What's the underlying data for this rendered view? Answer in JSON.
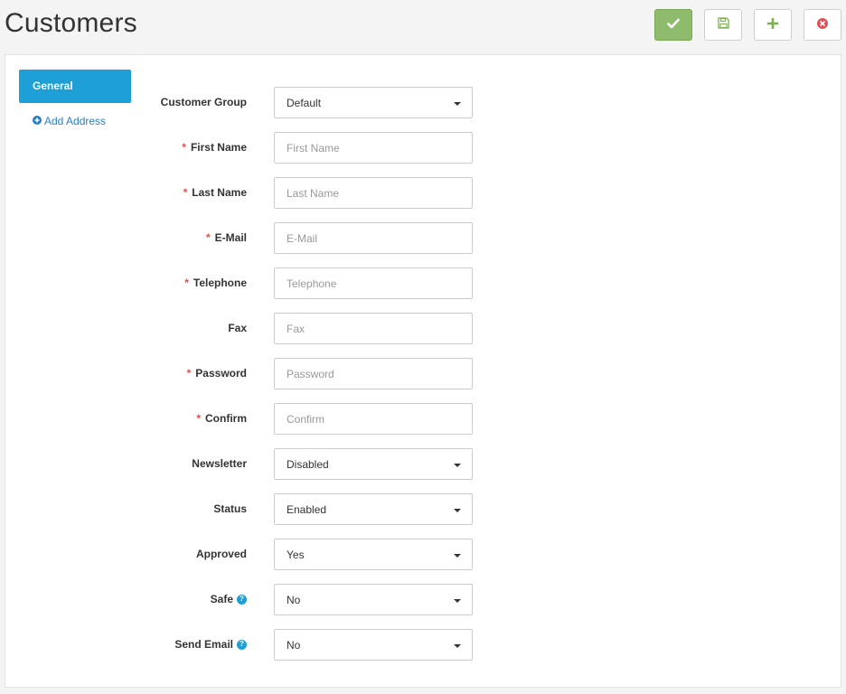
{
  "page": {
    "title": "Customers"
  },
  "toolbar": {
    "buttons": [
      {
        "name": "save-check",
        "icon": "check-icon"
      },
      {
        "name": "save-disk",
        "icon": "floppy-disk-icon"
      },
      {
        "name": "add",
        "icon": "plus-icon"
      },
      {
        "name": "cancel",
        "icon": "close-circle-icon"
      }
    ],
    "colors": {
      "primary": "#8fbb6c",
      "plus": "#7ab04d",
      "close": "#e0535b"
    }
  },
  "sidebar": {
    "active_tab": "General",
    "add_address": "Add Address"
  },
  "form": {
    "customer_group": {
      "label": "Customer Group",
      "value": "Default"
    },
    "first_name": {
      "label": "First Name",
      "placeholder": "First Name",
      "required": "*"
    },
    "last_name": {
      "label": "Last Name",
      "placeholder": "Last Name",
      "required": "*"
    },
    "email": {
      "label": "E-Mail",
      "placeholder": "E-Mail",
      "required": "*"
    },
    "telephone": {
      "label": "Telephone",
      "placeholder": "Telephone",
      "required": "*"
    },
    "fax": {
      "label": "Fax",
      "placeholder": "Fax"
    },
    "password": {
      "label": "Password",
      "placeholder": "Password",
      "required": "*"
    },
    "confirm": {
      "label": "Confirm",
      "placeholder": "Confirm",
      "required": "*"
    },
    "newsletter": {
      "label": "Newsletter",
      "value": "Disabled"
    },
    "status": {
      "label": "Status",
      "value": "Enabled"
    },
    "approved": {
      "label": "Approved",
      "value": "Yes"
    },
    "safe": {
      "label": "Safe",
      "value": "No",
      "help": "?"
    },
    "send_email": {
      "label": "Send Email",
      "value": "No",
      "help": "?"
    }
  }
}
